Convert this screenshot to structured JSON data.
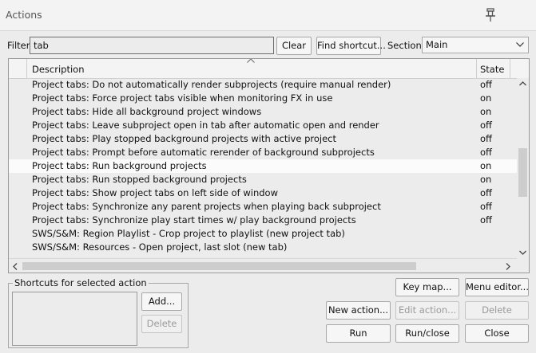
{
  "window": {
    "title": "Actions"
  },
  "icons": {
    "pin": "pin-icon",
    "dropdown": "chevron-down-icon",
    "sort": "sort-up-icon"
  },
  "filter": {
    "label": "Filter",
    "value": "tab",
    "clear": "Clear",
    "find_shortcut": "Find shortcut..."
  },
  "section": {
    "label": "Section:",
    "value": "Main"
  },
  "table": {
    "columns": [
      "Description",
      "State"
    ],
    "rows": [
      {
        "description": "Project tabs: Do not automatically render subprojects (require manual render)",
        "state": "off"
      },
      {
        "description": "Project tabs: Force project tabs visible when monitoring FX in use",
        "state": "on"
      },
      {
        "description": "Project tabs: Hide all background project windows",
        "state": "on"
      },
      {
        "description": "Project tabs: Leave subproject open in tab after automatic open and render",
        "state": "off"
      },
      {
        "description": "Project tabs: Play stopped background projects with active project",
        "state": "off"
      },
      {
        "description": "Project tabs: Prompt before automatic rerender of background subprojects",
        "state": "off"
      },
      {
        "description": "Project tabs: Run background projects",
        "state": "on",
        "selected": true
      },
      {
        "description": "Project tabs: Run stopped background projects",
        "state": "on"
      },
      {
        "description": "Project tabs: Show project tabs on left side of window",
        "state": "off"
      },
      {
        "description": "Project tabs: Synchronize any parent projects when playing back subproject",
        "state": "off"
      },
      {
        "description": "Project tabs: Synchronize play start times w/ play background projects",
        "state": "off"
      },
      {
        "description": "SWS/S&M: Region Playlist - Crop project to playlist (new project tab)",
        "state": ""
      },
      {
        "description": "SWS/S&M: Resources - Open project, last slot (new tab)",
        "state": ""
      }
    ]
  },
  "shortcuts": {
    "label": "Shortcuts for selected action",
    "add": "Add...",
    "delete": "Delete"
  },
  "buttons": {
    "key_map": "Key map...",
    "menu_editor": "Menu editor...",
    "new_action": "New action...",
    "edit_action": "Edit action...",
    "delete": "Delete",
    "run": "Run",
    "run_close": "Run/close",
    "close": "Close"
  }
}
